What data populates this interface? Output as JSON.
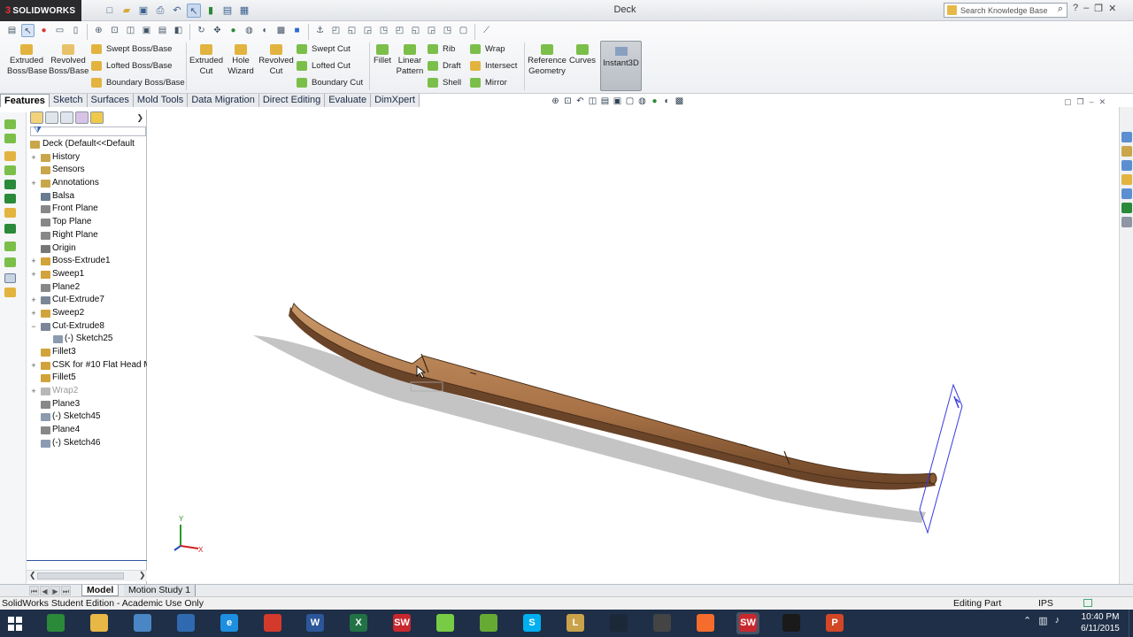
{
  "app": {
    "logo_text": "SOLIDWORKS",
    "window_title": "Deck"
  },
  "search": {
    "placeholder": "Search Knowledge Base"
  },
  "commands": {
    "extruded_boss": "Extruded Boss/Base",
    "revolved_boss": "Revolved Boss/Base",
    "swept_boss": "Swept Boss/Base",
    "lofted_boss": "Lofted Boss/Base",
    "boundary_boss": "Boundary Boss/Base",
    "extruded_cut": "Extruded Cut",
    "hole_wizard": "Hole Wizard",
    "revolved_cut": "Revolved Cut",
    "swept_cut": "Swept Cut",
    "lofted_cut": "Lofted Cut",
    "boundary_cut": "Boundary Cut",
    "fillet": "Fillet",
    "linear_pattern": "Linear Pattern",
    "rib": "Rib",
    "draft": "Draft",
    "shell": "Shell",
    "wrap": "Wrap",
    "intersect": "Intersect",
    "mirror": "Mirror",
    "reference_geometry": "Reference Geometry",
    "curves": "Curves",
    "instant3d": "Instant3D"
  },
  "tabs": [
    "Features",
    "Sketch",
    "Surfaces",
    "Mold Tools",
    "Data Migration",
    "Direct Editing",
    "Evaluate",
    "DimXpert"
  ],
  "tree": {
    "root": "Deck  (Default<<Default",
    "items": [
      {
        "label": "History",
        "icon": "history-icon",
        "expand": "+",
        "color": "#c9a64a"
      },
      {
        "label": "Sensors",
        "icon": "sensor-icon",
        "expand": "",
        "color": "#c9a64a"
      },
      {
        "label": "Annotations",
        "icon": "annotation-icon",
        "expand": "+",
        "color": "#c9a64a"
      },
      {
        "label": "Balsa",
        "icon": "material-icon",
        "expand": "",
        "color": "#6a7a90"
      },
      {
        "label": "Front Plane",
        "icon": "plane-icon",
        "expand": "",
        "color": "#888"
      },
      {
        "label": "Top Plane",
        "icon": "plane-icon",
        "expand": "",
        "color": "#888"
      },
      {
        "label": "Right Plane",
        "icon": "plane-icon",
        "expand": "",
        "color": "#888"
      },
      {
        "label": "Origin",
        "icon": "origin-icon",
        "expand": "",
        "color": "#777"
      },
      {
        "label": "Boss-Extrude1",
        "icon": "extrude-icon",
        "expand": "+",
        "color": "#d1a33a"
      },
      {
        "label": "Sweep1",
        "icon": "sweep-icon",
        "expand": "+",
        "color": "#d1a33a"
      },
      {
        "label": "Plane2",
        "icon": "plane-icon",
        "expand": "",
        "color": "#888"
      },
      {
        "label": "Cut-Extrude7",
        "icon": "cut-extrude-icon",
        "expand": "+",
        "color": "#7b8796"
      },
      {
        "label": "Sweep2",
        "icon": "sweep-icon",
        "expand": "+",
        "color": "#d1a33a"
      },
      {
        "label": "Cut-Extrude8",
        "icon": "cut-extrude-icon",
        "expand": "−",
        "color": "#7b8796"
      },
      {
        "label": "(-) Sketch25",
        "icon": "sketch-icon",
        "expand": "",
        "color": "#8c9bb0",
        "indent": true
      },
      {
        "label": "Fillet3",
        "icon": "fillet-icon",
        "expand": "",
        "color": "#d1a33a"
      },
      {
        "label": "CSK for #10 Flat Head M",
        "icon": "hole-icon",
        "expand": "+",
        "color": "#d1a33a"
      },
      {
        "label": "Fillet5",
        "icon": "fillet-icon",
        "expand": "",
        "color": "#d1a33a"
      },
      {
        "label": "Wrap2",
        "icon": "wrap-icon",
        "expand": "+",
        "color": "#b8b8b8",
        "gray": true
      },
      {
        "label": "Plane3",
        "icon": "plane-icon",
        "expand": "",
        "color": "#888"
      },
      {
        "label": "(-) Sketch45",
        "icon": "sketch-icon",
        "expand": "",
        "color": "#8c9bb0"
      },
      {
        "label": "Plane4",
        "icon": "plane-icon",
        "expand": "",
        "color": "#888"
      },
      {
        "label": "(-) Sketch46",
        "icon": "sketch-icon",
        "expand": "",
        "color": "#8c9bb0"
      }
    ]
  },
  "model_tabs": {
    "model": "Model",
    "motion": "Motion Study 1"
  },
  "status": {
    "edition": "SolidWorks Student Edition - Academic Use Only",
    "mode": "Editing Part",
    "units": "IPS"
  },
  "triad": {
    "x": "X",
    "y": "Y"
  },
  "taskbar": {
    "time": "10:40 PM",
    "date": "6/11/2015",
    "apps": [
      {
        "name": "store-app",
        "glyph": "",
        "color": "#2a8a3a"
      },
      {
        "name": "file-explorer",
        "glyph": "",
        "color": "#e8b746"
      },
      {
        "name": "network-app",
        "glyph": "",
        "color": "#4a86c5"
      },
      {
        "name": "desktop-app",
        "glyph": "",
        "color": "#2f6ab0"
      },
      {
        "name": "internet-explorer",
        "glyph": "e",
        "color": "#1e8fe0"
      },
      {
        "name": "chrome",
        "glyph": "",
        "color": "#d33a2c"
      },
      {
        "name": "word",
        "glyph": "W",
        "color": "#2b579a"
      },
      {
        "name": "excel",
        "glyph": "X",
        "color": "#217346"
      },
      {
        "name": "solidworks",
        "glyph": "SW",
        "color": "#c8282d"
      },
      {
        "name": "game-app",
        "glyph": "",
        "color": "#7c4"
      },
      {
        "name": "photo-app",
        "glyph": "",
        "color": "#6a3"
      },
      {
        "name": "skype",
        "glyph": "S",
        "color": "#00aff0"
      },
      {
        "name": "league-app",
        "glyph": "L",
        "color": "#c9a24a"
      },
      {
        "name": "steam",
        "glyph": "",
        "color": "#1b2838"
      },
      {
        "name": "unity-app",
        "glyph": "",
        "color": "#444"
      },
      {
        "name": "origin-app",
        "glyph": "",
        "color": "#f56c2d"
      },
      {
        "name": "solidworks-active",
        "glyph": "SW",
        "color": "#c8282d"
      },
      {
        "name": "terminal-app",
        "glyph": "",
        "color": "#1a1a1a"
      },
      {
        "name": "powerpoint",
        "glyph": "P",
        "color": "#d24726"
      }
    ]
  },
  "colors": {
    "wood": "#b07a4c",
    "wood_dark": "#5a3b22",
    "accent_blue": "#2a55a0",
    "selection_blue": "#3a3ae0"
  }
}
